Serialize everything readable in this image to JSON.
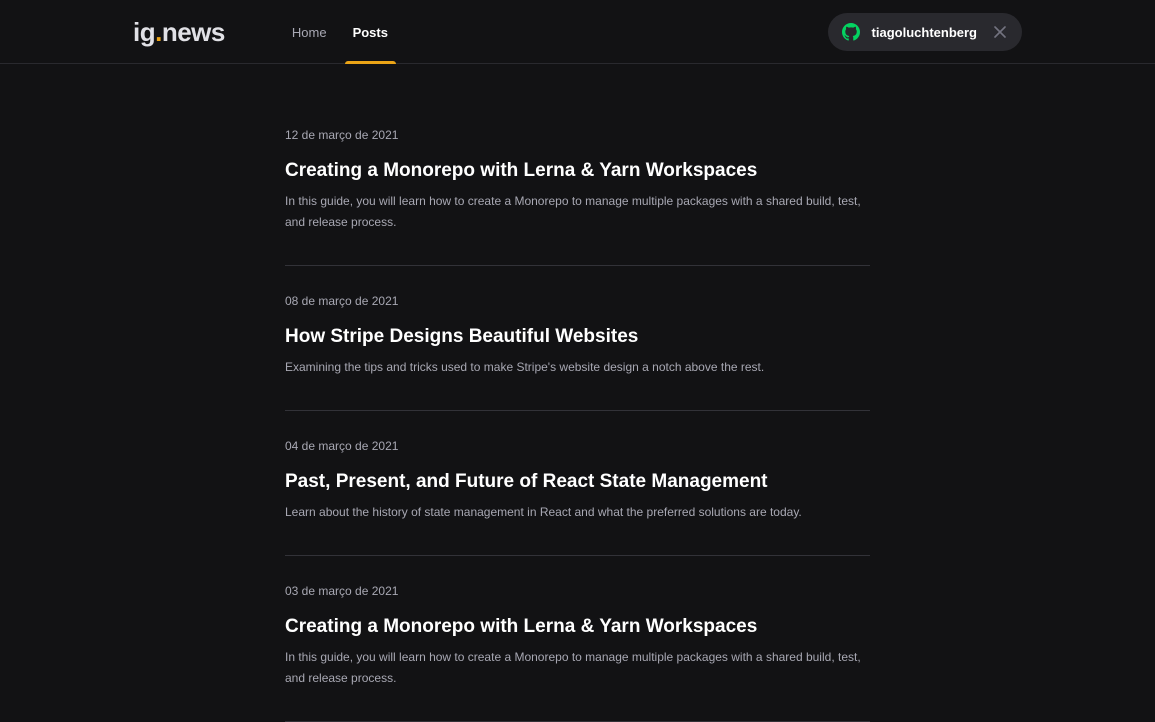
{
  "header": {
    "logo_main": "ig",
    "logo_dot": ".",
    "logo_tail": "news",
    "nav": [
      {
        "label": "Home",
        "active": false
      },
      {
        "label": "Posts",
        "active": true
      }
    ],
    "user": {
      "username": "tiagoluchtenberg",
      "provider_icon": "github-icon",
      "provider_icon_color": "#04d361",
      "close_icon": "close-icon"
    }
  },
  "colors": {
    "background": "#121214",
    "accent": "#eba417",
    "text_primary": "#ffffff",
    "text_secondary": "#a8a8b3"
  },
  "posts": [
    {
      "date": "12 de março de 2021",
      "title": "Creating a Monorepo with Lerna & Yarn Workspaces",
      "excerpt": "In this guide, you will learn how to create a Monorepo to manage multiple packages with a shared build, test, and release process."
    },
    {
      "date": "08 de março de 2021",
      "title": "How Stripe Designs Beautiful Websites",
      "excerpt": "Examining the tips and tricks used to make Stripe's website design a notch above the rest."
    },
    {
      "date": "04 de março de 2021",
      "title": "Past, Present, and Future of React State Management",
      "excerpt": "Learn about the history of state management in React and what the preferred solutions are today."
    },
    {
      "date": "03 de março de 2021",
      "title": "Creating a Monorepo with Lerna & Yarn Workspaces",
      "excerpt": "In this guide, you will learn how to create a Monorepo to manage multiple packages with a shared build, test, and release process."
    }
  ]
}
